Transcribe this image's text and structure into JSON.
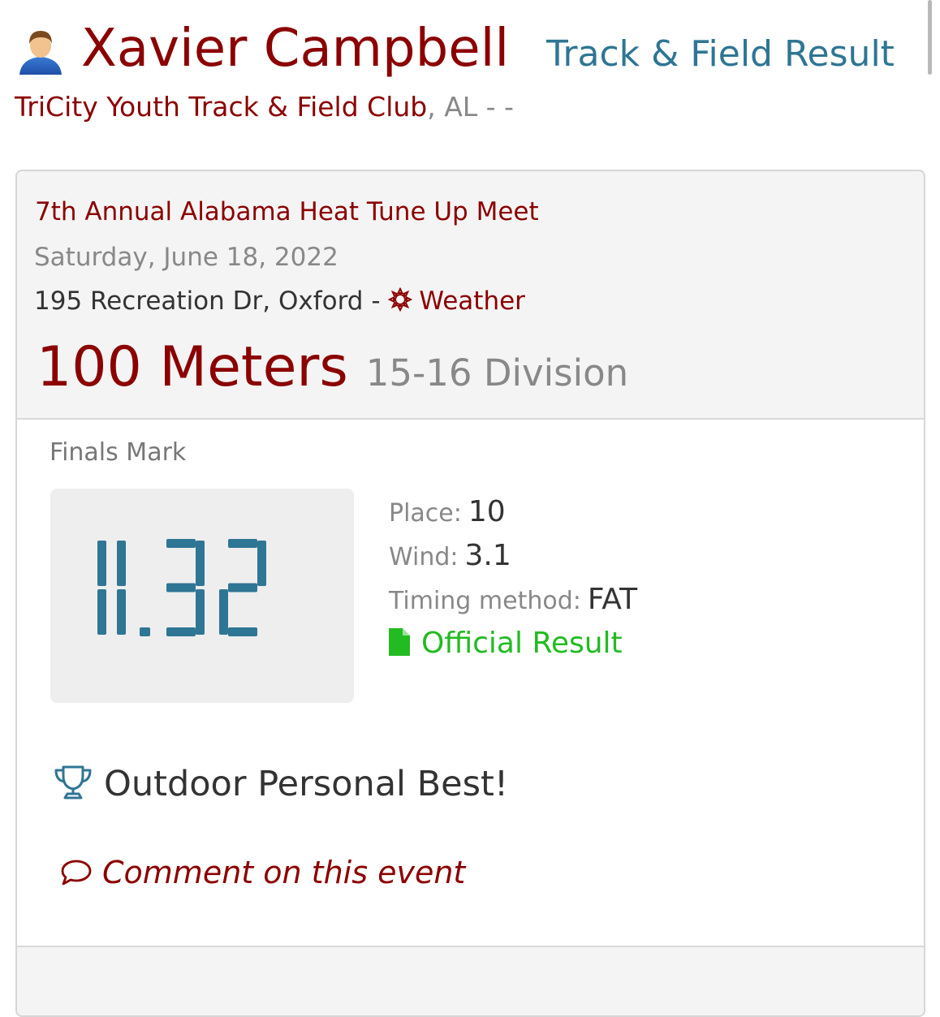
{
  "header": {
    "athlete_name": "Xavier Campbell",
    "subtitle": "Track & Field Result",
    "team_name": "TriCity Youth Track & Field Club",
    "team_location": ", AL - -",
    "avatar_icon": "user-avatar-icon"
  },
  "meet": {
    "name": "7th Annual Alabama Heat Tune Up Meet",
    "date": "Saturday, June 18, 2022",
    "address": "195 Recreation Dr, Oxford -",
    "weather_label": "Weather",
    "weather_icon": "sun-icon"
  },
  "event": {
    "name": "100 Meters",
    "division": "15-16 Division"
  },
  "result": {
    "marks_label": "Finals Mark",
    "mark": "11.32",
    "details": [
      {
        "label": "Place:",
        "value": "10"
      },
      {
        "label": "Wind:",
        "value": "3.1"
      },
      {
        "label": "Timing method:",
        "value": "FAT"
      }
    ],
    "official_label": "Official Result",
    "official_icon": "document-icon",
    "pb_label": "Outdoor Personal Best!",
    "pb_icon": "trophy-icon",
    "comment_label": "Comment on this event",
    "comment_icon": "comment-icon"
  },
  "colors": {
    "brand_red": "#8b0000",
    "accent_blue": "#2f7594",
    "success_green": "#22bb22",
    "muted_gray": "#888888"
  }
}
